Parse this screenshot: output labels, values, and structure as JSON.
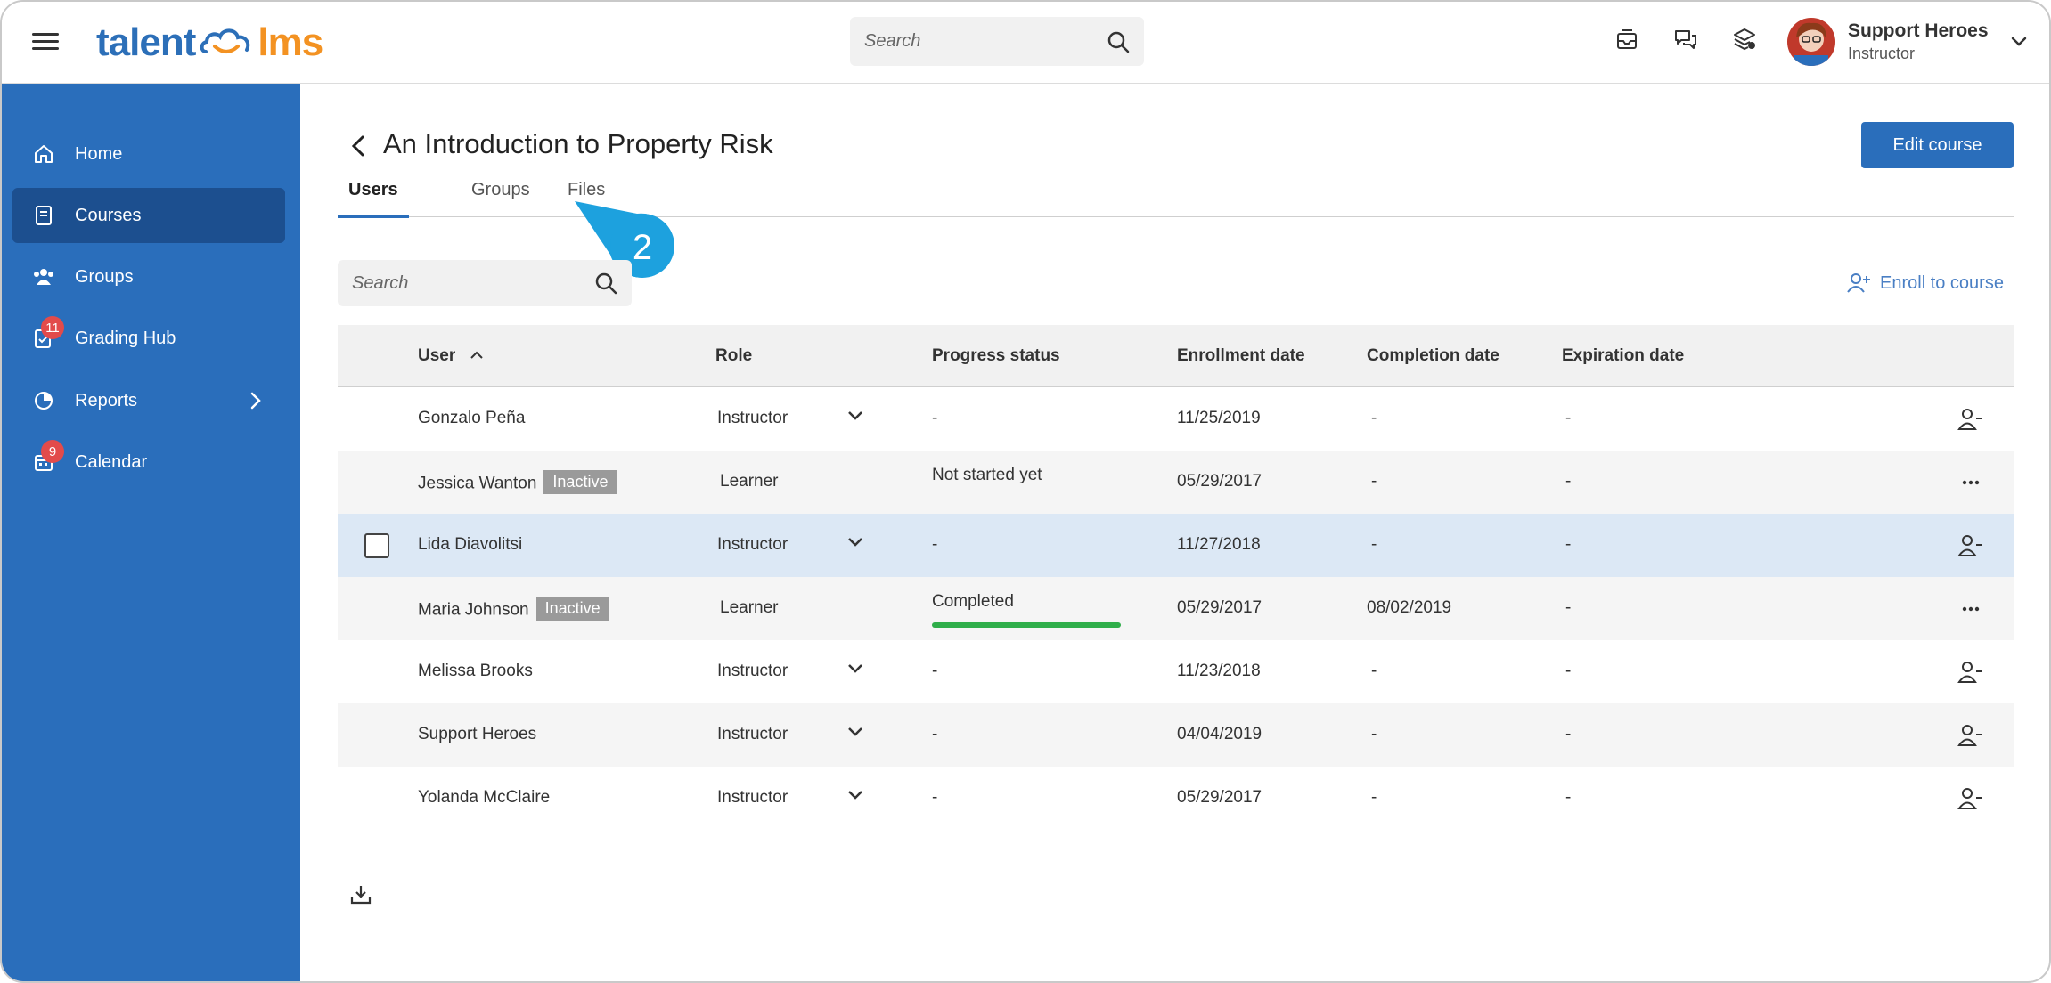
{
  "header": {
    "logo_left": "talent",
    "logo_right": "lms",
    "search_placeholder": "Search",
    "icons": [
      "inbox-icon",
      "chat-icon",
      "layers-icon"
    ],
    "profile": {
      "name": "Support Heroes",
      "role": "Instructor"
    }
  },
  "sidebar": {
    "items": [
      {
        "label": "Home",
        "icon": "home-icon"
      },
      {
        "label": "Courses",
        "icon": "book-icon",
        "active": true
      },
      {
        "label": "Groups",
        "icon": "users-icon"
      },
      {
        "label": "Grading Hub",
        "icon": "grading-icon",
        "badge": "11"
      },
      {
        "label": "Reports",
        "icon": "pie-chart-icon"
      },
      {
        "label": "Calendar",
        "icon": "calendar-icon",
        "badge": "9"
      }
    ]
  },
  "page": {
    "title": "An Introduction to Property Risk",
    "edit_button": "Edit course",
    "tabs": [
      "Users",
      "Groups",
      "Files"
    ],
    "callout_number": "2",
    "search_placeholder": "Search",
    "enroll_label": "Enroll to course"
  },
  "table": {
    "headers": [
      "User",
      "Role",
      "Progress status",
      "Enrollment date",
      "Completion date",
      "Expiration date"
    ],
    "rows": [
      {
        "user": "Gonzalo Peña",
        "inactive": "",
        "role": "Instructor",
        "progress": "-",
        "enrolled": "11/25/2019",
        "completed": "-",
        "expires": "-"
      },
      {
        "user": "Jessica Wanton",
        "inactive": "Inactive",
        "role": "Learner",
        "progress": "Not started yet",
        "enrolled": "05/29/2017",
        "completed": "-",
        "expires": "-"
      },
      {
        "user": "Lida Diavolitsi",
        "inactive": "",
        "role": "Instructor",
        "progress": "-",
        "enrolled": "11/27/2018",
        "completed": "-",
        "expires": "-"
      },
      {
        "user": "Maria Johnson",
        "inactive": "Inactive",
        "role": "Learner",
        "progress": "Completed",
        "progress_fraction": 1.0,
        "enrolled": "05/29/2017",
        "completed": "08/02/2019",
        "expires": "-"
      },
      {
        "user": "Melissa Brooks",
        "inactive": "",
        "role": "Instructor",
        "progress": "-",
        "enrolled": "11/23/2018",
        "completed": "-",
        "expires": "-"
      },
      {
        "user": "Support Heroes",
        "inactive": "",
        "role": "Instructor",
        "progress": "-",
        "enrolled": "04/04/2019",
        "completed": "-",
        "expires": "-"
      },
      {
        "user": "Yolanda McClaire",
        "inactive": "",
        "role": "Instructor",
        "progress": "-",
        "enrolled": "05/29/2017",
        "completed": "-",
        "expires": "-"
      }
    ]
  },
  "colors": {
    "brand_blue": "#2a6ebb",
    "sidebar_active": "#1c4f8f",
    "callout": "#1da1de",
    "progress_green": "#2fae4a",
    "badge_red": "#e24b4b"
  }
}
